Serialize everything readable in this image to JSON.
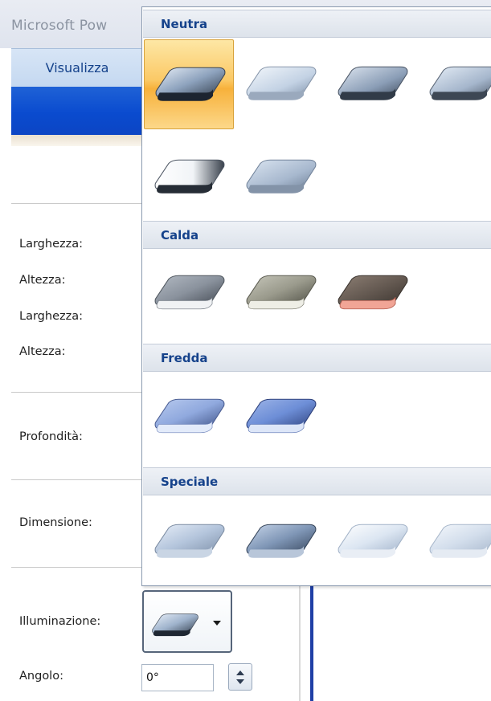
{
  "app": {
    "title": "Microsoft Pow"
  },
  "ribbon": {
    "tab_view": "Visualizza"
  },
  "panel": {
    "width1_label": "Larghezza:",
    "height1_label": "Altezza:",
    "width2_label": "Larghezza:",
    "height2_label": "Altezza:",
    "depth_label": "Profondità:",
    "size_label": "Dimensione:",
    "lighting_label": "Illuminazione:",
    "angle_label": "Angolo:",
    "angle_value": "0°"
  },
  "gallery": {
    "categories": [
      {
        "name": "Neutra",
        "count": 6
      },
      {
        "name": "Calda",
        "count": 3
      },
      {
        "name": "Fredda",
        "count": 2
      },
      {
        "name": "Speciale",
        "count": 4
      }
    ],
    "selected": "Neutra-1"
  },
  "colors": {
    "accent": "#15428b",
    "selection": "#f9c25a",
    "ribbon_blue": "#0a4bcf"
  }
}
